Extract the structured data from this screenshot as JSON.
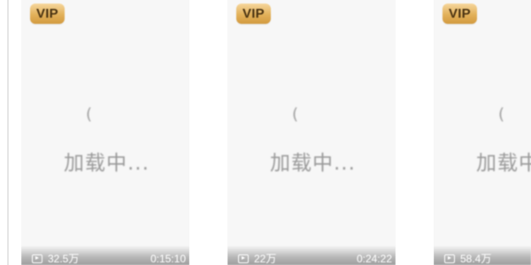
{
  "cards": [
    {
      "badge": "VIP",
      "loading_text": "加载中...",
      "spinner_glyph": "(",
      "views": "32.5万",
      "duration": "0:15:10"
    },
    {
      "badge": "VIP",
      "loading_text": "加载中...",
      "spinner_glyph": "(",
      "views": "22万",
      "duration": "0:24:22"
    },
    {
      "badge": "VIP",
      "loading_text": "加载中...",
      "spinner_glyph": "(",
      "views": "58.4万",
      "duration": ""
    }
  ],
  "colors": {
    "vip_badge_top": "#f6d79d",
    "vip_badge_bottom": "#d39a3f",
    "loading_text": "#9a9a9a",
    "card_background": "#f7f7f7"
  },
  "icons": {
    "play_count": "play-count-icon",
    "spinner": "loading-spinner-icon"
  }
}
